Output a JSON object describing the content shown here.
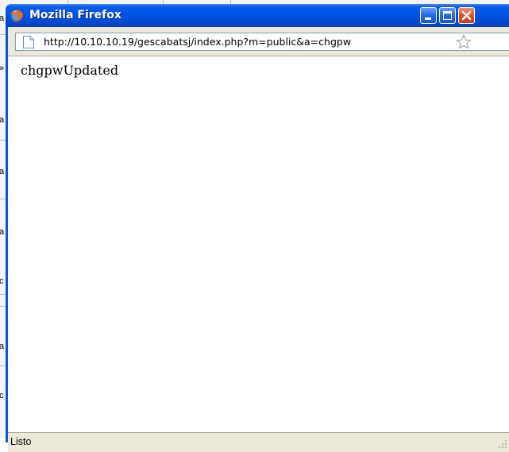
{
  "window": {
    "title": "Mozilla Firefox",
    "controls": [
      "minimize",
      "maximize",
      "close"
    ]
  },
  "addressbar": {
    "url": "http://10.10.10.19/gescabatsj/index.php?m=public&a=chgpw"
  },
  "page": {
    "body_text": "chgpwUpdated"
  },
  "statusbar": {
    "text": "Listo"
  },
  "background": {
    "fragments": [
      "a",
      "»",
      "a",
      "a",
      "a",
      "c",
      "a",
      "c"
    ]
  },
  "colors": {
    "titlebar": "#0054e3",
    "close_button": "#e0532c",
    "chrome": "#ece9d8"
  }
}
